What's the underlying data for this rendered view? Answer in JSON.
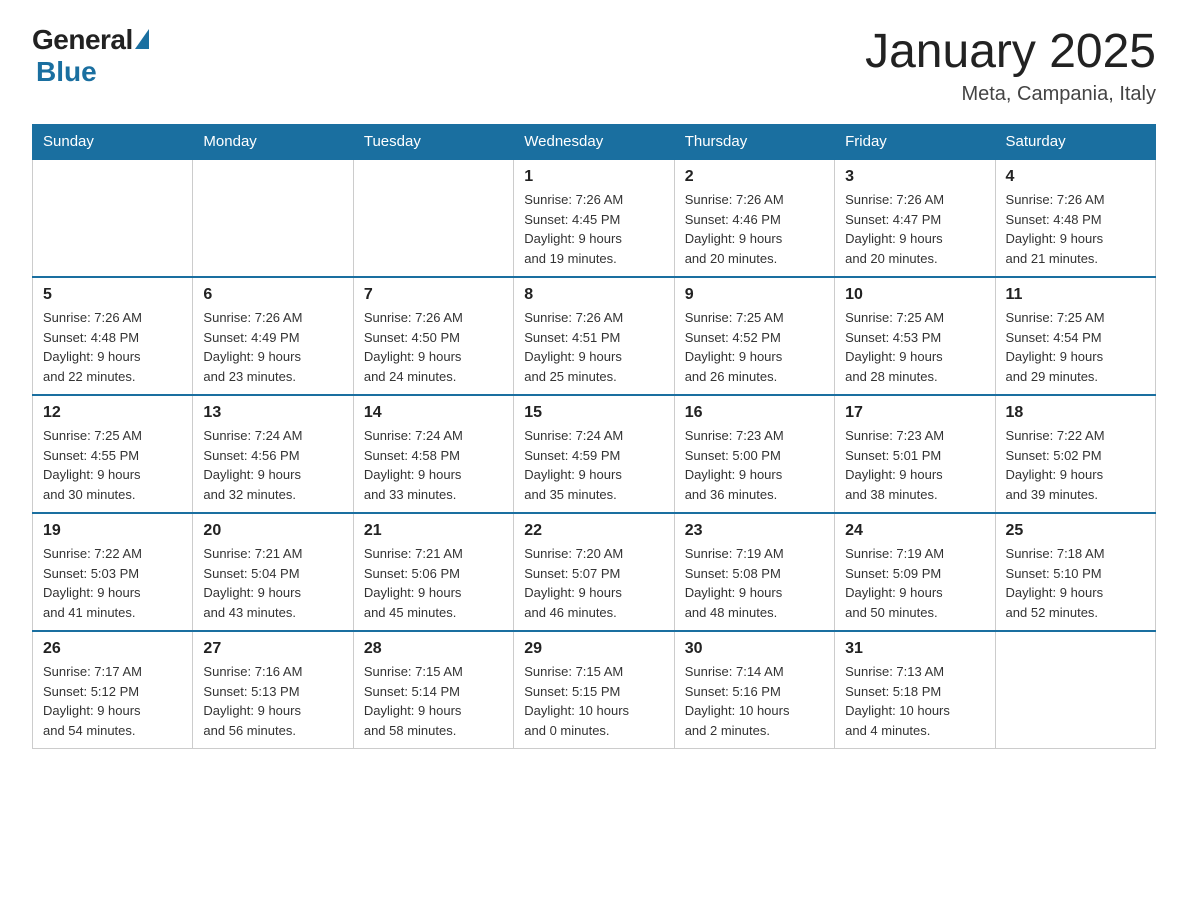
{
  "header": {
    "logo_general": "General",
    "logo_blue": "Blue",
    "month_title": "January 2025",
    "location": "Meta, Campania, Italy"
  },
  "days_of_week": [
    "Sunday",
    "Monday",
    "Tuesday",
    "Wednesday",
    "Thursday",
    "Friday",
    "Saturday"
  ],
  "weeks": [
    [
      {
        "day": "",
        "info": []
      },
      {
        "day": "",
        "info": []
      },
      {
        "day": "",
        "info": []
      },
      {
        "day": "1",
        "info": [
          "Sunrise: 7:26 AM",
          "Sunset: 4:45 PM",
          "Daylight: 9 hours",
          "and 19 minutes."
        ]
      },
      {
        "day": "2",
        "info": [
          "Sunrise: 7:26 AM",
          "Sunset: 4:46 PM",
          "Daylight: 9 hours",
          "and 20 minutes."
        ]
      },
      {
        "day": "3",
        "info": [
          "Sunrise: 7:26 AM",
          "Sunset: 4:47 PM",
          "Daylight: 9 hours",
          "and 20 minutes."
        ]
      },
      {
        "day": "4",
        "info": [
          "Sunrise: 7:26 AM",
          "Sunset: 4:48 PM",
          "Daylight: 9 hours",
          "and 21 minutes."
        ]
      }
    ],
    [
      {
        "day": "5",
        "info": [
          "Sunrise: 7:26 AM",
          "Sunset: 4:48 PM",
          "Daylight: 9 hours",
          "and 22 minutes."
        ]
      },
      {
        "day": "6",
        "info": [
          "Sunrise: 7:26 AM",
          "Sunset: 4:49 PM",
          "Daylight: 9 hours",
          "and 23 minutes."
        ]
      },
      {
        "day": "7",
        "info": [
          "Sunrise: 7:26 AM",
          "Sunset: 4:50 PM",
          "Daylight: 9 hours",
          "and 24 minutes."
        ]
      },
      {
        "day": "8",
        "info": [
          "Sunrise: 7:26 AM",
          "Sunset: 4:51 PM",
          "Daylight: 9 hours",
          "and 25 minutes."
        ]
      },
      {
        "day": "9",
        "info": [
          "Sunrise: 7:25 AM",
          "Sunset: 4:52 PM",
          "Daylight: 9 hours",
          "and 26 minutes."
        ]
      },
      {
        "day": "10",
        "info": [
          "Sunrise: 7:25 AM",
          "Sunset: 4:53 PM",
          "Daylight: 9 hours",
          "and 28 minutes."
        ]
      },
      {
        "day": "11",
        "info": [
          "Sunrise: 7:25 AM",
          "Sunset: 4:54 PM",
          "Daylight: 9 hours",
          "and 29 minutes."
        ]
      }
    ],
    [
      {
        "day": "12",
        "info": [
          "Sunrise: 7:25 AM",
          "Sunset: 4:55 PM",
          "Daylight: 9 hours",
          "and 30 minutes."
        ]
      },
      {
        "day": "13",
        "info": [
          "Sunrise: 7:24 AM",
          "Sunset: 4:56 PM",
          "Daylight: 9 hours",
          "and 32 minutes."
        ]
      },
      {
        "day": "14",
        "info": [
          "Sunrise: 7:24 AM",
          "Sunset: 4:58 PM",
          "Daylight: 9 hours",
          "and 33 minutes."
        ]
      },
      {
        "day": "15",
        "info": [
          "Sunrise: 7:24 AM",
          "Sunset: 4:59 PM",
          "Daylight: 9 hours",
          "and 35 minutes."
        ]
      },
      {
        "day": "16",
        "info": [
          "Sunrise: 7:23 AM",
          "Sunset: 5:00 PM",
          "Daylight: 9 hours",
          "and 36 minutes."
        ]
      },
      {
        "day": "17",
        "info": [
          "Sunrise: 7:23 AM",
          "Sunset: 5:01 PM",
          "Daylight: 9 hours",
          "and 38 minutes."
        ]
      },
      {
        "day": "18",
        "info": [
          "Sunrise: 7:22 AM",
          "Sunset: 5:02 PM",
          "Daylight: 9 hours",
          "and 39 minutes."
        ]
      }
    ],
    [
      {
        "day": "19",
        "info": [
          "Sunrise: 7:22 AM",
          "Sunset: 5:03 PM",
          "Daylight: 9 hours",
          "and 41 minutes."
        ]
      },
      {
        "day": "20",
        "info": [
          "Sunrise: 7:21 AM",
          "Sunset: 5:04 PM",
          "Daylight: 9 hours",
          "and 43 minutes."
        ]
      },
      {
        "day": "21",
        "info": [
          "Sunrise: 7:21 AM",
          "Sunset: 5:06 PM",
          "Daylight: 9 hours",
          "and 45 minutes."
        ]
      },
      {
        "day": "22",
        "info": [
          "Sunrise: 7:20 AM",
          "Sunset: 5:07 PM",
          "Daylight: 9 hours",
          "and 46 minutes."
        ]
      },
      {
        "day": "23",
        "info": [
          "Sunrise: 7:19 AM",
          "Sunset: 5:08 PM",
          "Daylight: 9 hours",
          "and 48 minutes."
        ]
      },
      {
        "day": "24",
        "info": [
          "Sunrise: 7:19 AM",
          "Sunset: 5:09 PM",
          "Daylight: 9 hours",
          "and 50 minutes."
        ]
      },
      {
        "day": "25",
        "info": [
          "Sunrise: 7:18 AM",
          "Sunset: 5:10 PM",
          "Daylight: 9 hours",
          "and 52 minutes."
        ]
      }
    ],
    [
      {
        "day": "26",
        "info": [
          "Sunrise: 7:17 AM",
          "Sunset: 5:12 PM",
          "Daylight: 9 hours",
          "and 54 minutes."
        ]
      },
      {
        "day": "27",
        "info": [
          "Sunrise: 7:16 AM",
          "Sunset: 5:13 PM",
          "Daylight: 9 hours",
          "and 56 minutes."
        ]
      },
      {
        "day": "28",
        "info": [
          "Sunrise: 7:15 AM",
          "Sunset: 5:14 PM",
          "Daylight: 9 hours",
          "and 58 minutes."
        ]
      },
      {
        "day": "29",
        "info": [
          "Sunrise: 7:15 AM",
          "Sunset: 5:15 PM",
          "Daylight: 10 hours",
          "and 0 minutes."
        ]
      },
      {
        "day": "30",
        "info": [
          "Sunrise: 7:14 AM",
          "Sunset: 5:16 PM",
          "Daylight: 10 hours",
          "and 2 minutes."
        ]
      },
      {
        "day": "31",
        "info": [
          "Sunrise: 7:13 AM",
          "Sunset: 5:18 PM",
          "Daylight: 10 hours",
          "and 4 minutes."
        ]
      },
      {
        "day": "",
        "info": []
      }
    ]
  ]
}
